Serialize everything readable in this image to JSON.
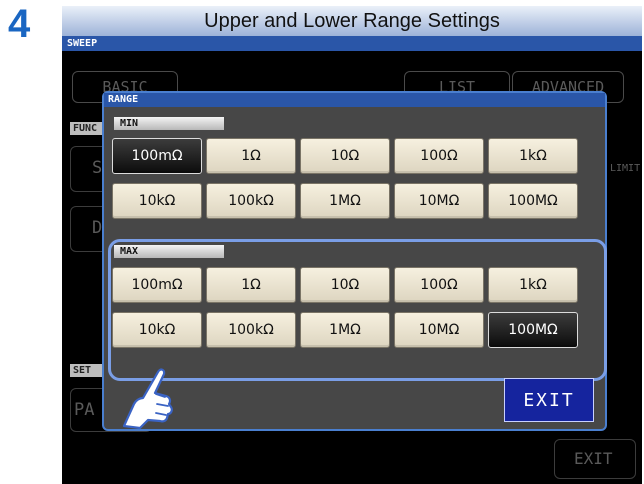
{
  "step": "4",
  "heading": "Upper and Lower Range Settings",
  "screen": {
    "mode_strip": "SWEEP",
    "background": {
      "tab_basic": "BASIC",
      "tab_list": "LIST",
      "tab_advanced": "ADVANCED",
      "func_label": "FUNC",
      "set_label": "SET",
      "limit_text": "LIMIT",
      "exit_text": "EXIT",
      "ghost_s": "S",
      "ghost_d": "D",
      "ghost_pa": "PA"
    },
    "range_dialog": {
      "title": "RANGE",
      "min": {
        "label": "MIN",
        "rows": [
          [
            "100mΩ",
            "1Ω",
            "10Ω",
            "100Ω",
            "1kΩ"
          ],
          [
            "10kΩ",
            "100kΩ",
            "1MΩ",
            "10MΩ",
            "100MΩ"
          ]
        ],
        "selected": "100mΩ"
      },
      "max": {
        "label": "MAX",
        "rows": [
          [
            "100mΩ",
            "1Ω",
            "10Ω",
            "100Ω",
            "1kΩ"
          ],
          [
            "10kΩ",
            "100kΩ",
            "1MΩ",
            "10MΩ",
            "100MΩ"
          ]
        ],
        "selected": "100MΩ"
      },
      "exit_label": "EXIT"
    }
  },
  "colors": {
    "step_number": "#1a66c2",
    "title_strip": "#2a56a8",
    "exit_button": "#15249e",
    "highlight_frame": "#7a9ee6"
  }
}
